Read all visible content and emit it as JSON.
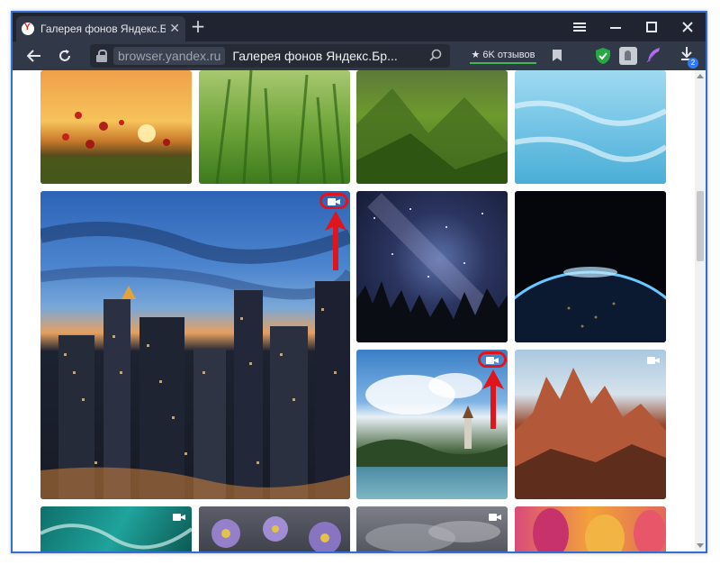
{
  "browser": {
    "tab_title": "Галерея фонов Яндекс.Б",
    "tab_close": "✕",
    "new_tab": "+",
    "url_domain": "browser.yandex.ru",
    "url_page_title": "Галерея фонов Яндекс.Бр...",
    "reviews_label": "★ 6K отзывов",
    "downloads_count": "2",
    "icons": {
      "menu": "hamburger-icon",
      "minimize": "minimize-icon",
      "maximize": "maximize-icon",
      "close": "close-icon",
      "back": "back-arrow-icon",
      "reload": "reload-icon",
      "lock": "lock-icon",
      "find": "search-in-page-icon",
      "bookmark": "bookmark-icon",
      "download": "download-icon"
    }
  },
  "gallery": {
    "tiles": [
      {
        "name": "tile-sunset-poppies",
        "video": false
      },
      {
        "name": "tile-green-grass",
        "video": false
      },
      {
        "name": "tile-green-mountains",
        "video": false
      },
      {
        "name": "tile-frozen-ice",
        "video": false
      },
      {
        "name": "tile-city-night",
        "video": true,
        "highlighted": true
      },
      {
        "name": "tile-starry-sky-forest",
        "video": false
      },
      {
        "name": "tile-earth-from-space",
        "video": false
      },
      {
        "name": "tile-lake-bled",
        "video": true,
        "highlighted": true
      },
      {
        "name": "tile-red-cliffs",
        "video": true
      },
      {
        "name": "tile-turquoise-coast",
        "video": true
      },
      {
        "name": "tile-purple-asters",
        "video": false
      },
      {
        "name": "tile-storm-clouds",
        "video": true
      },
      {
        "name": "tile-tulips",
        "video": false
      }
    ],
    "colors": {
      "highlight_red": "#e0151b",
      "window_border": "#2f6fd6",
      "toolbar_bg": "#313847",
      "titlebar_bg": "#1f2430"
    }
  }
}
